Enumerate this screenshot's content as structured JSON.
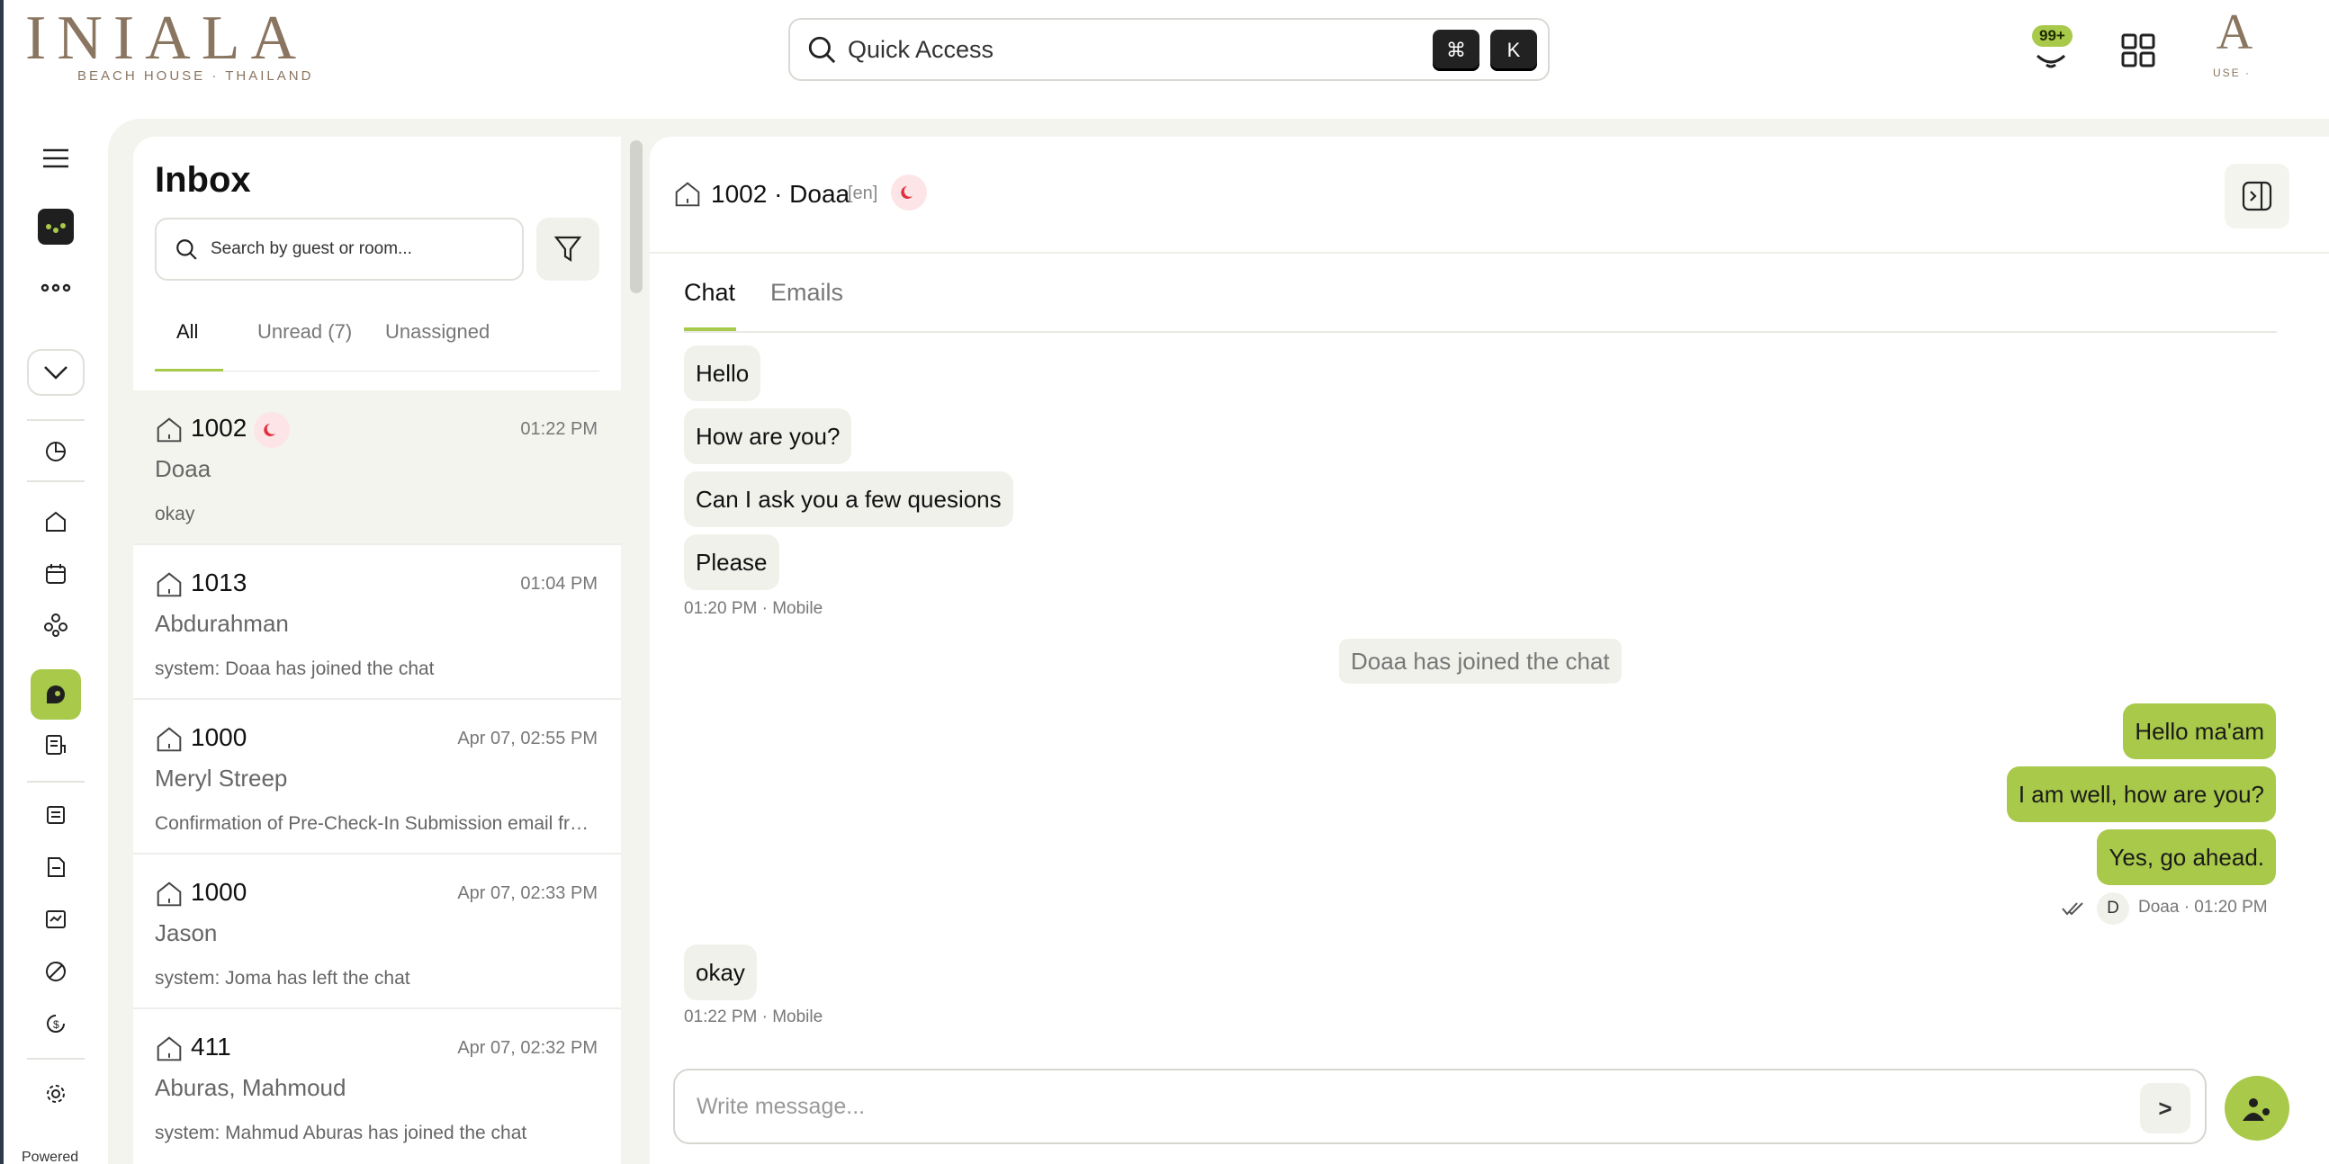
{
  "brand": {
    "name": "INIALA",
    "subtitle": "BEACH HOUSE · THAILAND",
    "small_logo": "A",
    "small_logo_sub": "USE ·"
  },
  "quick_access": {
    "label": "Quick Access",
    "key1": "⌘",
    "key2": "K"
  },
  "notifications": {
    "badge": "99+"
  },
  "colors": {
    "accent": "#a8c94a",
    "brand": "#8a7560",
    "frame_bg": "#f4f4ef",
    "night_badge": "#fde4e6",
    "night_icon": "#e0303e"
  },
  "sidebar": {
    "icons": [
      "menu-icon",
      "app-logo-icon",
      "more-dots-icon",
      "collapse-chevron-icon",
      "dashboard-icon",
      "home-icon",
      "calendar-icon",
      "people-icon",
      "chat-icon",
      "tasks-icon",
      "reports-icon",
      "documents-icon",
      "invoice-icon",
      "analytics-icon",
      "payments-icon",
      "settings-icon"
    ],
    "powered": "Powered"
  },
  "inbox": {
    "title": "Inbox",
    "search_placeholder": "Search by guest or room...",
    "tabs": [
      {
        "label": "All"
      },
      {
        "label": "Unread (7)"
      },
      {
        "label": "Unassigned"
      }
    ],
    "conversations": [
      {
        "room": "1002",
        "time": "01:22 PM",
        "guest": "Doaa",
        "preview": "okay",
        "night": true
      },
      {
        "room": "1013",
        "time": "01:04 PM",
        "guest": "Abdurahman",
        "preview": "system: Doaa has joined the chat"
      },
      {
        "room": "1000",
        "time": "Apr 07, 02:55 PM",
        "guest": "Meryl Streep",
        "preview": "Confirmation of Pre-Check-In Submission email from sender"
      },
      {
        "room": "1000",
        "time": "Apr 07, 02:33 PM",
        "guest": "Jason",
        "preview": "system: Joma has left the chat"
      },
      {
        "room": "411",
        "time": "Apr 07, 02:32 PM",
        "guest": "Aburas, Mahmoud",
        "preview": "system: Mahmud Aburas has joined the chat"
      }
    ]
  },
  "chat": {
    "header": {
      "room_guest": "1002 · Doaa",
      "lang": "[en]"
    },
    "tabs": [
      {
        "label": "Chat"
      },
      {
        "label": "Emails"
      }
    ],
    "messages_in_1": [
      "Hello",
      "How are you?",
      "Can I ask you a few quesions",
      "Please"
    ],
    "meta_in_1": "01:20 PM  ·  Mobile",
    "system_message": "Doaa has joined the chat",
    "messages_out": [
      "Hello ma'am",
      "I am well, how are you?",
      "Yes, go ahead."
    ],
    "meta_out": {
      "avatar": "D",
      "text": "Doaa  ·  01:20 PM"
    },
    "messages_in_2": [
      "okay"
    ],
    "meta_in_2": "01:22 PM  ·  Mobile",
    "composer_placeholder": "Write message...",
    "send_label": ">"
  }
}
